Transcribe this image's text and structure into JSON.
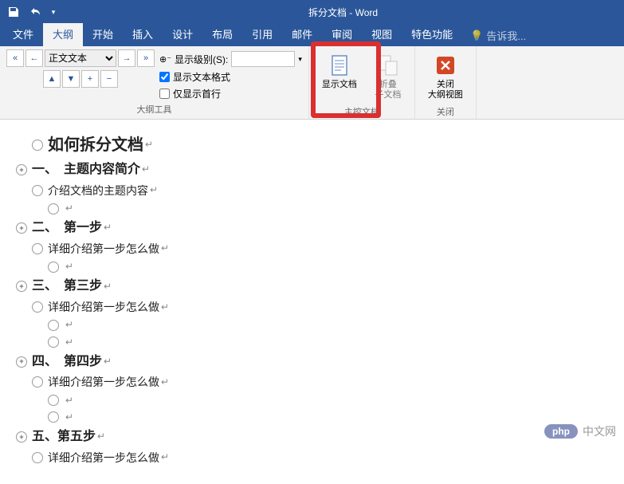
{
  "title": "拆分文档 - Word",
  "tabs": [
    "文件",
    "大纲",
    "开始",
    "插入",
    "设计",
    "布局",
    "引用",
    "邮件",
    "审阅",
    "视图",
    "特色功能"
  ],
  "active_tab_index": 1,
  "tell_me": "告诉我...",
  "ribbon": {
    "level_value": "正文文本",
    "show_level_label": "显示级别(S):",
    "show_level_value": "",
    "show_format": "显示文本格式",
    "show_firstline": "仅显示首行",
    "group_outline_tools": "大纲工具",
    "btn_show_doc": "显示文档",
    "btn_collapse_1": "折叠",
    "btn_collapse_2": "子文档",
    "group_master_doc": "主控文档",
    "btn_close_1": "关闭",
    "btn_close_2": "大纲视图",
    "group_close": "关闭"
  },
  "document": {
    "title": "如何拆分文档",
    "sections": [
      {
        "heading": "一、　主题内容简介",
        "body": "介绍文档的主题内容"
      },
      {
        "heading": "二、　第一步",
        "body": "详细介绍第一步怎么做"
      },
      {
        "heading": "三、　第三步",
        "body": "详细介绍第一步怎么做"
      },
      {
        "heading": "四、　第四步",
        "body": "详细介绍第一步怎么做"
      },
      {
        "heading": "五、第五步",
        "body": "详细介绍第一步怎么做"
      }
    ]
  },
  "watermark": {
    "badge": "php",
    "text": "中文网"
  }
}
